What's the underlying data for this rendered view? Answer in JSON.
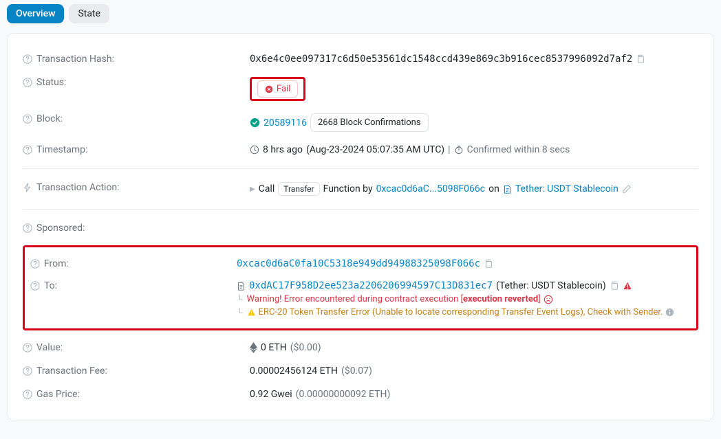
{
  "tabs": {
    "overview": "Overview",
    "state": "State"
  },
  "labels": {
    "hash": "Transaction Hash:",
    "status": "Status:",
    "block": "Block:",
    "timestamp": "Timestamp:",
    "action": "Transaction Action:",
    "sponsored": "Sponsored:",
    "from": "From:",
    "to": "To:",
    "value": "Value:",
    "fee": "Transaction Fee:",
    "gas": "Gas Price:"
  },
  "hash": "0x6e4c0ee097317c6d50e53561dc1548ccd439e869c3b916cec8537996092d7af2",
  "status_text": "Fail",
  "block": {
    "number": "20589116",
    "confirm": "2668 Block Confirmations"
  },
  "timestamp": {
    "ago": "8 hrs ago",
    "full": "(Aug-23-2024 05:07:35 AM UTC)",
    "sep": "|",
    "confirmed": "Confirmed within 8 secs"
  },
  "action": {
    "call": "Call",
    "method": "Transfer",
    "by": "Function by",
    "sender_short": "0xcac0d6aC...5098F066c",
    "on": "on",
    "contract_name": "Tether: USDT Stablecoin"
  },
  "from": "0xcac0d6aC0fa10C5318e949dd94988325098F066c",
  "to": {
    "addr": "0xdAC17F958D2ee523a2206206994597C13D831ec7",
    "name": "(Tether: USDT Stablecoin)"
  },
  "warnings": {
    "line1a": "Warning! Error encountered during contract execution [",
    "line1b": "execution reverted",
    "line1c": "]",
    "line2": "ERC-20 Token Transfer Error (Unable to locate corresponding Transfer Event Logs), Check with Sender."
  },
  "value": {
    "amt": "0 ETH",
    "usd": "($0.00)"
  },
  "fee": {
    "eth": "0.00002456124 ETH",
    "usd": "($0.07)"
  },
  "gas": {
    "gwei": "0.92 Gwei",
    "eth": "(0.00000000092 ETH)"
  }
}
